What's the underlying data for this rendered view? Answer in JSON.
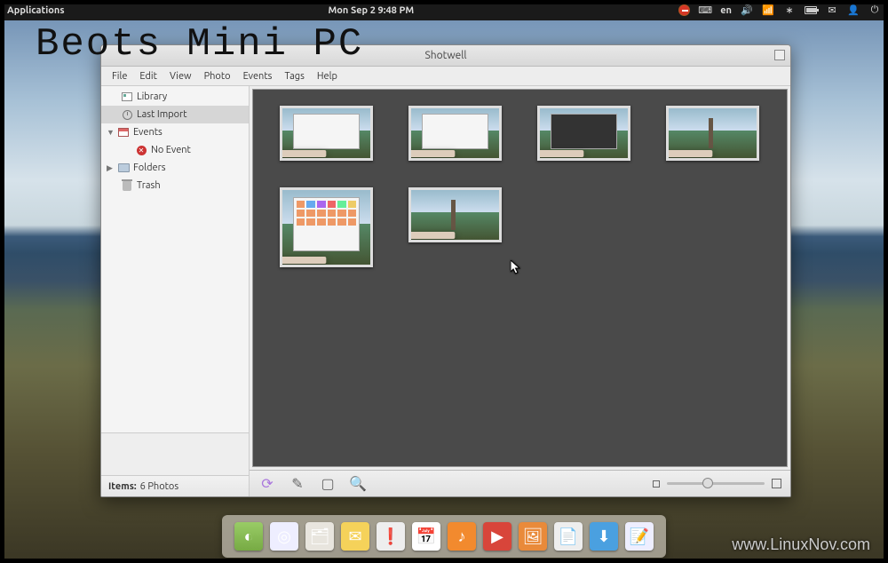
{
  "top_panel": {
    "applications": "Applications",
    "clock": "Mon Sep  2  9:48 PM",
    "lang": "en"
  },
  "watermark": "Beots Mini PC",
  "corner_watermark": "www.LinuxNov.com",
  "window": {
    "title": "Shotwell",
    "menu": {
      "file": "File",
      "edit": "Edit",
      "view": "View",
      "photo": "Photo",
      "events": "Events",
      "tags": "Tags",
      "help": "Help"
    }
  },
  "sidebar": {
    "library": "Library",
    "last_import": "Last Import",
    "events": "Events",
    "no_event": "No Event",
    "folders": "Folders",
    "trash": "Trash"
  },
  "statusbar": {
    "label": "Items:",
    "value": "6 Photos"
  },
  "dock_items": [
    {
      "name": "yin-yang",
      "bg": "linear-gradient(#9c6,#7a4)",
      "glyph": "◐"
    },
    {
      "name": "chromium",
      "bg": "#eef",
      "glyph": "◎"
    },
    {
      "name": "files",
      "bg": "#e8e5de",
      "glyph": "🗂"
    },
    {
      "name": "mail",
      "bg": "#f5d25a",
      "glyph": "✉"
    },
    {
      "name": "software-center",
      "bg": "#eee",
      "glyph": "❗"
    },
    {
      "name": "calendar",
      "bg": "#fff",
      "glyph": "📅"
    },
    {
      "name": "music",
      "bg": "#f28a2e",
      "glyph": "♪"
    },
    {
      "name": "videos",
      "bg": "#d8453a",
      "glyph": "▶"
    },
    {
      "name": "photos",
      "bg": "#e98a3a",
      "glyph": "🖼"
    },
    {
      "name": "text-editor",
      "bg": "#eee",
      "glyph": "📄"
    },
    {
      "name": "downloads",
      "bg": "#4aa0e0",
      "glyph": "⬇"
    },
    {
      "name": "notes",
      "bg": "#eef",
      "glyph": "📝"
    }
  ]
}
